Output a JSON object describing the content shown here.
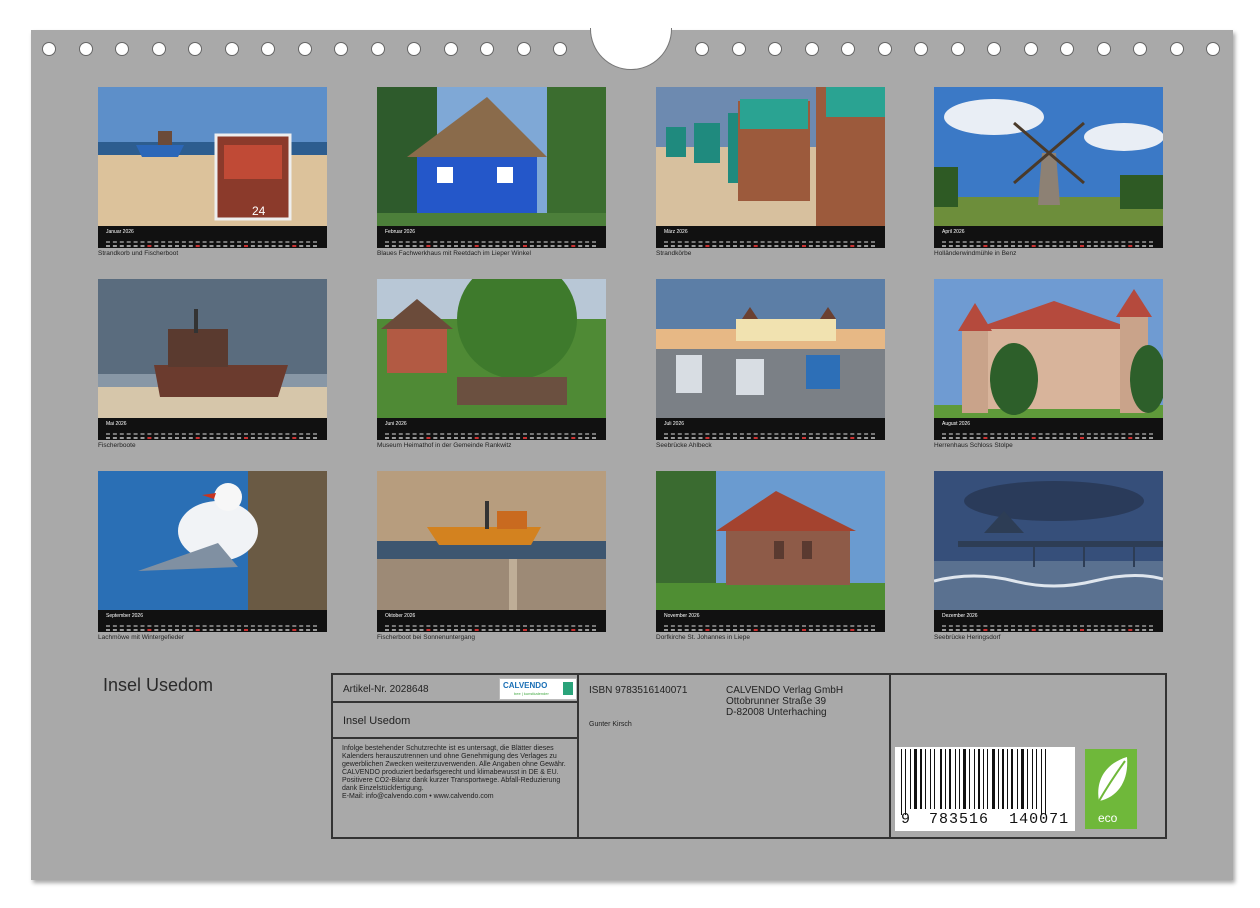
{
  "calendar_title": "Insel Usedom",
  "months": [
    {
      "name": "Januar 2026",
      "caption": "Strandkorb und Fischerboot",
      "scene": "beach"
    },
    {
      "name": "Februar 2026",
      "caption": "Blaues Fachwerkhaus mit Reetdach im Lieper Winkel",
      "scene": "house"
    },
    {
      "name": "März 2026",
      "caption": "Strandkörbe",
      "scene": "chairs"
    },
    {
      "name": "April 2026",
      "caption": "Holländerwindmühle in Benz",
      "scene": "windmill"
    },
    {
      "name": "Mai 2026",
      "caption": "Fischerboote",
      "scene": "boat"
    },
    {
      "name": "Juni 2026",
      "caption": "Museum Heimathof in der Gemeinde Rankwitz",
      "scene": "museum"
    },
    {
      "name": "Juli 2026",
      "caption": "Seebrücke Ahlbeck",
      "scene": "pier"
    },
    {
      "name": "August 2026",
      "caption": "Herrenhaus Schloss Stolpe",
      "scene": "castle"
    },
    {
      "name": "September 2026",
      "caption": "Lachmöwe mit Wintergefieder",
      "scene": "gull"
    },
    {
      "name": "Oktober 2026",
      "caption": "Fischerboot bei Sonnenuntergang",
      "scene": "sunset"
    },
    {
      "name": "November 2026",
      "caption": "Dorfkirche St. Johannes in Liepe",
      "scene": "church"
    },
    {
      "name": "Dezember 2026",
      "caption": "Seebrücke Heringsdorf",
      "scene": "heringsdorf"
    }
  ],
  "info": {
    "article": "Artikel-Nr. 2028648",
    "logo_text": "CALVENDO",
    "logo_sub": "bee | kunstkalender",
    "box_title": "Insel Usedom",
    "legal": "Infolge bestehender Schutzrechte ist es untersagt, die Blätter dieses Kalenders herauszutrennen und ohne Genehmigung des Verlages zu gewerblichen Zwecken weiterzuverwenden. Alle Angaben ohne Gewähr.",
    "legal2": "CALVENDO produziert bedarfsgerecht und klimabewusst in DE & EU. Positivere CO2-Bilanz dank kurzer Transportwege. Abfall-Reduzierung dank Einzelstückfertigung.",
    "legal3": "E-Mail: info@calvendo.com • www.calvendo.com",
    "isbn": "ISBN 9783516140071",
    "author": "Gunter Kirsch",
    "publisher": "CALVENDO Verlag GmbH",
    "street": "Ottobrunner Straße 39",
    "city": "D-82008 Unterhaching",
    "barcode_digits": {
      "first": "9",
      "group1": "783516",
      "group2": "140071"
    },
    "eco_label": "eco"
  }
}
